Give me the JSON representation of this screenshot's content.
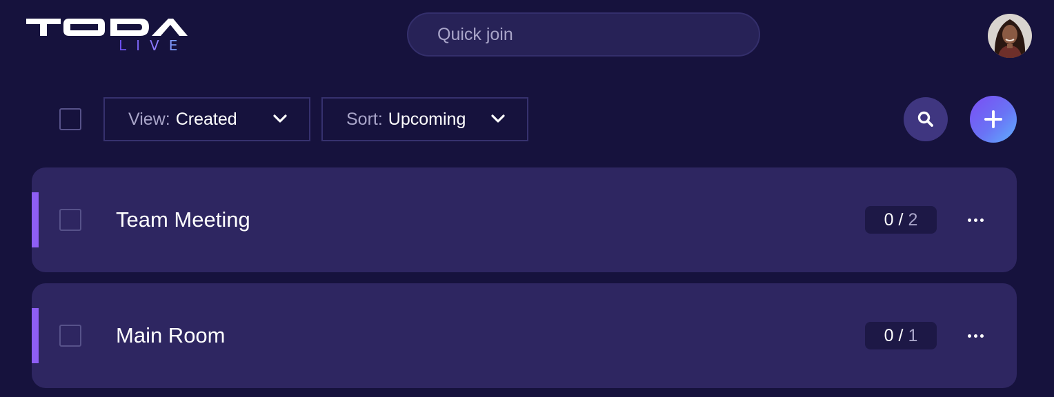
{
  "app": {
    "logo_main": "TODA",
    "logo_sub": "LIVE"
  },
  "header": {
    "quick_join_placeholder": "Quick join"
  },
  "toolbar": {
    "view_prefix": "View:",
    "view_value": "Created",
    "sort_prefix": "Sort:",
    "sort_value": "Upcoming"
  },
  "rooms": [
    {
      "name": "Team Meeting",
      "count_current": "0",
      "count_separator": "/",
      "count_total": "2"
    },
    {
      "name": "Main Room",
      "count_current": "0",
      "count_separator": "/",
      "count_total": "1"
    }
  ],
  "icons": {
    "search": "search-icon",
    "add": "plus-icon",
    "more": "more-horizontal-icon",
    "chevron": "chevron-down-icon",
    "avatar": "user-avatar"
  },
  "colors": {
    "background": "#16123d",
    "card": "#2e2661",
    "accent": "#8e5ef5",
    "input": "#272257",
    "muted_text": "#a9a5c9"
  }
}
